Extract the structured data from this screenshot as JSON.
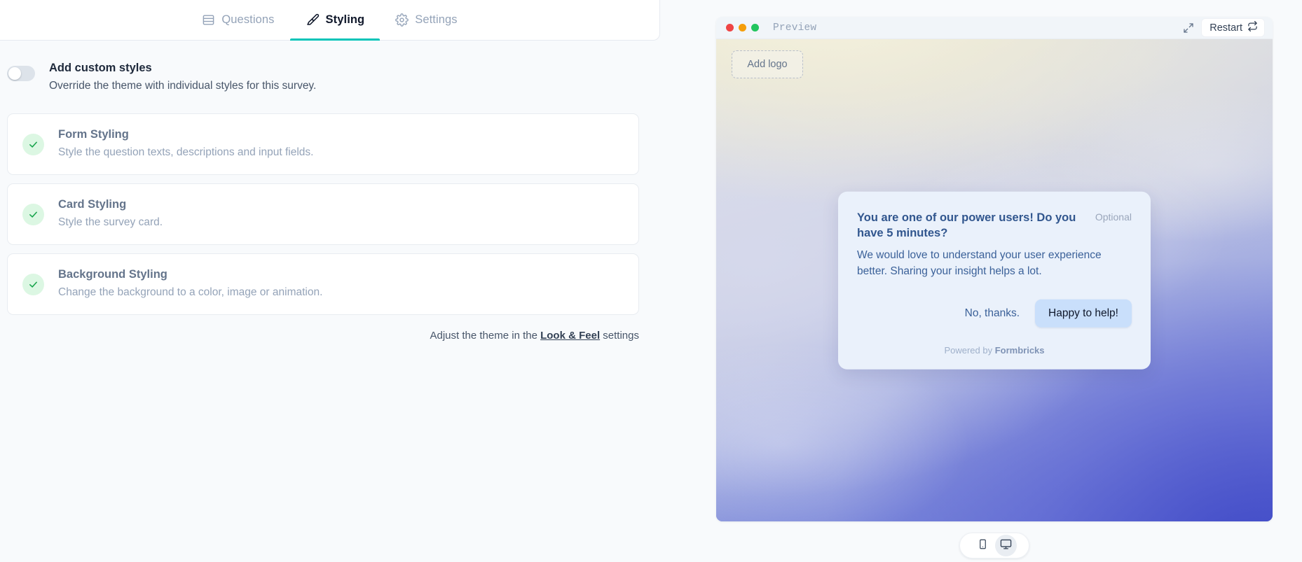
{
  "tabs": [
    {
      "label": "Questions",
      "icon": "rows-icon",
      "active": false
    },
    {
      "label": "Styling",
      "icon": "brush-icon",
      "active": true
    },
    {
      "label": "Settings",
      "icon": "gear-icon",
      "active": false
    }
  ],
  "custom_styles": {
    "title": "Add custom styles",
    "subtitle": "Override the theme with individual styles for this survey.",
    "toggle_state": "off"
  },
  "styling_cards": [
    {
      "title": "Form Styling",
      "subtitle": "Style the question texts, descriptions and input fields.",
      "status_icon": "check-circle-icon"
    },
    {
      "title": "Card Styling",
      "subtitle": "Style the survey card.",
      "status_icon": "check-circle-icon"
    },
    {
      "title": "Background Styling",
      "subtitle": "Change the background to a color, image or animation.",
      "status_icon": "check-circle-icon"
    }
  ],
  "theme_note": {
    "prefix": "Adjust the theme in the ",
    "link": "Look & Feel",
    "suffix": " settings"
  },
  "preview": {
    "title": "Preview",
    "restart_label": "Restart",
    "restart_icon": "repeat-icon",
    "expand_icon": "expand-icon",
    "traffic_lights": [
      "#ef4444",
      "#f59e0b",
      "#22c55e"
    ],
    "add_logo_label": "Add logo"
  },
  "survey": {
    "headline": "You are one of our power users! Do you have 5 minutes?",
    "optional_label": "Optional",
    "subheader": "We would love to understand your user experience better. Sharing your insight helps a lot.",
    "dismiss_label": "No, thanks.",
    "submit_label": "Happy to help!",
    "powered_prefix": "Powered by ",
    "powered_brand": "Formbricks"
  },
  "device_toggle": {
    "options": [
      {
        "name": "mobile",
        "icon": "phone-icon",
        "selected": false
      },
      {
        "name": "desktop",
        "icon": "monitor-icon",
        "selected": true
      }
    ]
  },
  "colors": {
    "accent": "#00c4b8",
    "check_bg": "#dcf7e3",
    "check_mark": "#16a34a",
    "survey_card_bg": "#eaf1fb",
    "survey_headline": "#31568e",
    "primary_button": "#c9dffb"
  }
}
